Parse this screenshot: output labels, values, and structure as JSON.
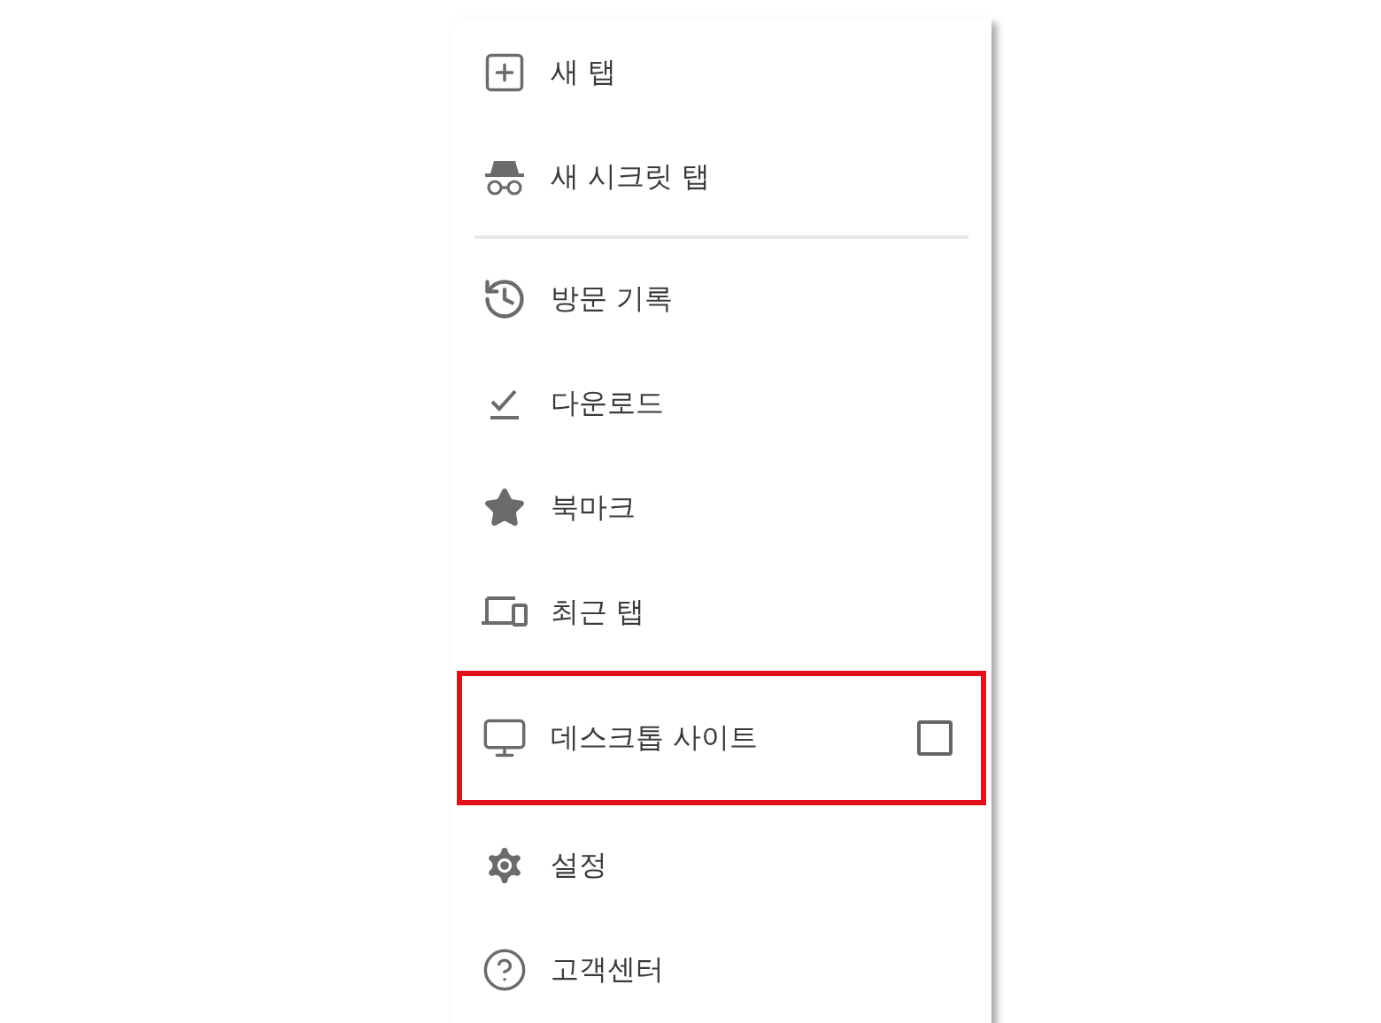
{
  "menu": {
    "sections": [
      {
        "items": [
          {
            "kind": "item",
            "label": "새 탭",
            "highlighted": false
          },
          {
            "kind": "item",
            "label": "새 시크릿 탭",
            "highlighted": false
          }
        ]
      },
      {
        "items": [
          {
            "kind": "item",
            "label": "방문 기록",
            "highlighted": false
          },
          {
            "kind": "item",
            "label": "다운로드",
            "highlighted": false
          },
          {
            "kind": "item",
            "label": "북마크",
            "highlighted": false
          },
          {
            "kind": "item",
            "label": "최근 탭",
            "highlighted": false
          },
          {
            "kind": "checkbox",
            "label": "데스크톱 사이트",
            "checked": false,
            "highlighted": true
          },
          {
            "kind": "item",
            "label": "설정",
            "highlighted": false
          },
          {
            "kind": "item",
            "label": "고객센터",
            "highlighted": false
          }
        ]
      }
    ]
  }
}
